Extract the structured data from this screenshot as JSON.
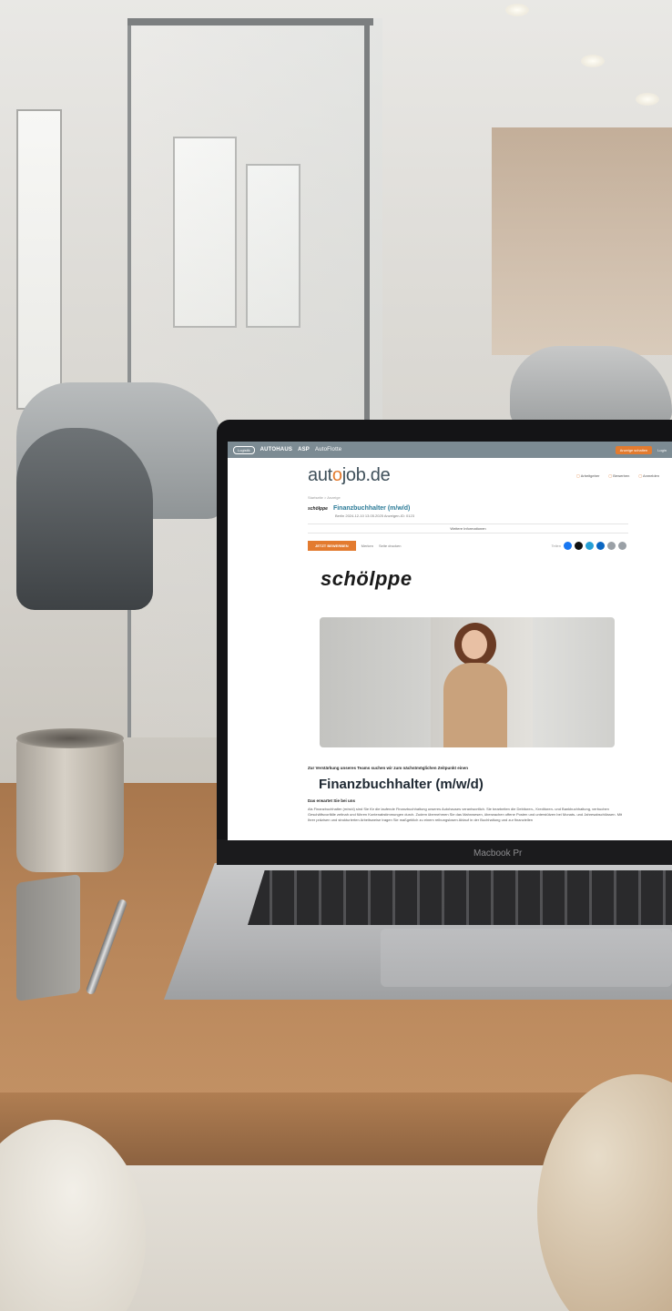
{
  "site": {
    "topbar_pill": "Logistik",
    "topbar_brands": [
      "AUTOHAUS",
      "ASP",
      "AutoFlotte"
    ],
    "topbar_cta": "Anzeige schalten",
    "topbar_login": "Login",
    "logo_prefix": "aut",
    "logo_mark": "o",
    "logo_suffix": "job.de",
    "nav": [
      "Arbeitgeber",
      "Bewerben",
      "Anmelden"
    ]
  },
  "breadcrumb": "Startseite > Anzeige",
  "job": {
    "company_short": "schölppe",
    "title": "Finanzbuchhalter (m/w/d)",
    "meta": "Berlin   2024-12-10   13.05.2025   Anzeigen-ID: 0123",
    "more_info": "Weitere Informationen",
    "apply_button": "JETZT BEWERBEN",
    "save": "Merken",
    "print": "Seite drucken",
    "share_label": "Teilen",
    "company_logo": "schölppe",
    "intro": "Zur Verstärkung unseres Teams suchen wir zum nächstmöglichen Zeitpunkt einen",
    "headline": "Finanzbuchhalter (m/w/d)",
    "section": "Das erwartet Sie bei uns",
    "body": "Als Finanzbuchhalter (m/w/d) sind Sie für die laufende Finanzbuchhaltung unseres Autohauses verantwortlich. Sie bearbeiten die Debitoren-, Kreditoren- und Bankbuchhaltung, verbuchen Geschäftsvorfälle zeitnah und führen Kontenabstimmungen durch. Zudem übernehmen Sie das Mahnwesen, überwachen offene Posten und unterstützen bei Monats- und Jahresabschlüssen. Mit Ihrer präzisen und strukturierten Arbeitsweise tragen Sie maßgeblich zu einem reibungslosen Ablauf in der Buchhaltung und zur finanziellen"
  },
  "laptop": {
    "model": "Macbook Pr"
  },
  "colors": {
    "accent": "#e37b2f",
    "topbar": "#7c8b93",
    "title_blue": "#2a7a97"
  },
  "share_colors": [
    "#1877f2",
    "#111111",
    "#25a0d6",
    "#0a66c2",
    "#9aa0a6",
    "#9aa0a6"
  ]
}
